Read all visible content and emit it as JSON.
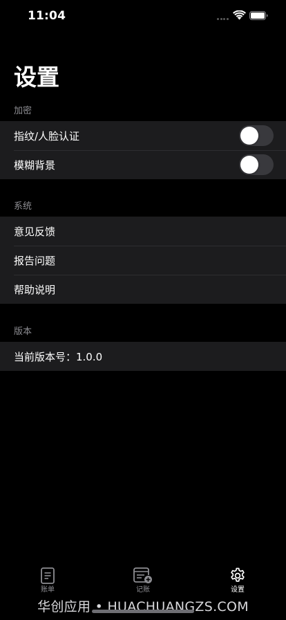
{
  "status_bar": {
    "time": "11:04"
  },
  "page": {
    "title": "设置"
  },
  "sections": [
    {
      "header": "加密",
      "rows": [
        {
          "label": "指纹/人脸认证",
          "toggle_on": false
        },
        {
          "label": "模糊背景",
          "toggle_on": false
        }
      ]
    },
    {
      "header": "系统",
      "rows": [
        {
          "label": "意见反馈"
        },
        {
          "label": "报告问题"
        },
        {
          "label": "帮助说明"
        }
      ]
    },
    {
      "header": "版本",
      "rows": [
        {
          "label": "当前版本号：1.0.0"
        }
      ]
    }
  ],
  "tab_bar": {
    "tabs": [
      {
        "label": "账单",
        "icon": "bill-icon",
        "active": false
      },
      {
        "label": "记账",
        "icon": "add-record-icon",
        "active": false
      },
      {
        "label": "设置",
        "icon": "gear-icon",
        "active": true
      }
    ]
  },
  "watermark": "华创应用 • HUACHUANGZS.COM",
  "colors": {
    "background": "#000000",
    "group_background": "#1c1c1e",
    "section_header": "#8d8d92",
    "toggle_off": "#39393d",
    "tab_inactive": "#8e8e93",
    "tab_active": "#ffffff"
  }
}
